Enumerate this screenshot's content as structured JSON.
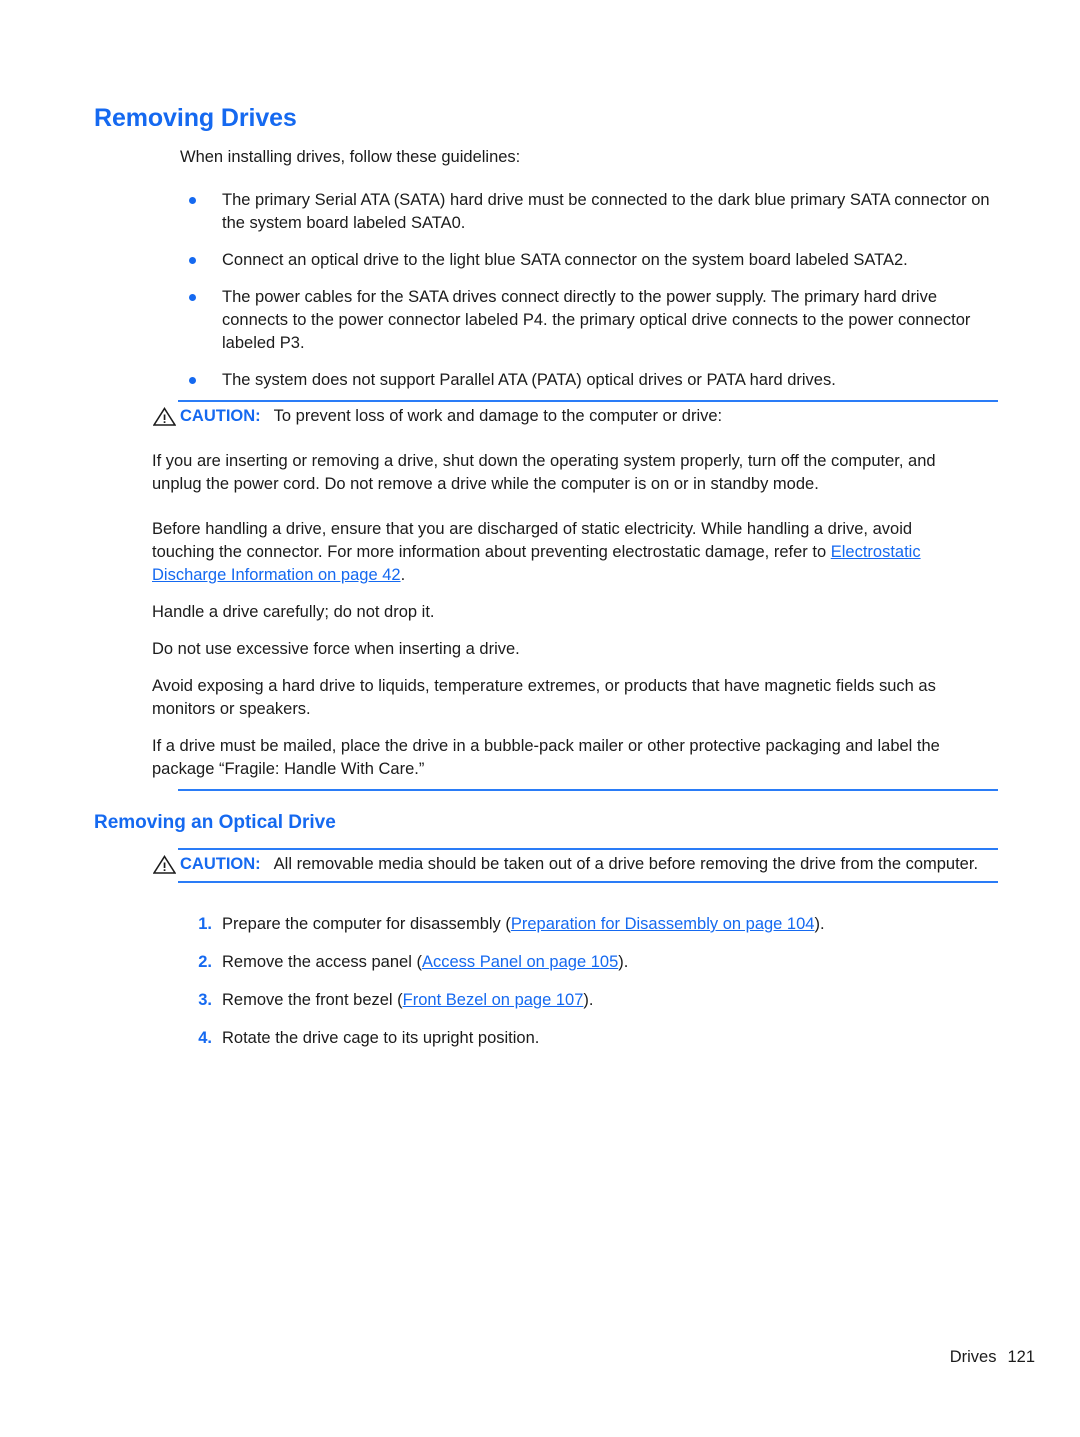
{
  "page": {
    "title": "Removing Drives",
    "intro": "When installing drives, follow these guidelines:",
    "accent_color": "#1569f0",
    "rule_color": "#2a7cf7",
    "text_color": "#1b1b1b"
  },
  "guidelines": [
    "The primary Serial ATA (SATA) hard drive must be connected to the dark blue primary SATA connector on the system board labeled SATA0.",
    "Connect an optical drive to the light blue SATA connector on the system board labeled SATA2.",
    "The power cables for the SATA drives connect directly to the power supply. The primary hard drive connects to the power connector labeled P4. the primary optical drive connects to the power connector labeled P3.",
    "The system does not support Parallel ATA (PATA) optical drives or PATA hard drives."
  ],
  "caution_1": {
    "icon": "warning-triangle-icon",
    "label": "CAUTION:",
    "lead": "To prevent loss of work and damage to the computer or drive:",
    "paragraphs": [
      "If you are inserting or removing a drive, shut down the operating system properly, turn off the computer, and unplug the power cord. Do not remove a drive while the computer is on or in standby mode.",
      "Handle a drive carefully; do not drop it.",
      "Do not use excessive force when inserting a drive.",
      "Avoid exposing a hard drive to liquids, temperature extremes, or products that have magnetic fields such as monitors or speakers.",
      "If a drive must be mailed, place the drive in a bubble-pack mailer or other protective packaging and label the package “Fragile: Handle With Care.”"
    ],
    "esd_paragraph": {
      "before": "Before handling a drive, ensure that you are discharged of static electricity. While handling a drive, avoid touching the connector. For more information about preventing electrostatic damage, refer to ",
      "link": "Electrostatic Discharge Information on page 42",
      "after": "."
    }
  },
  "section_2": {
    "title": "Removing an Optical Drive",
    "caution": {
      "icon": "warning-triangle-icon",
      "label": "CAUTION:",
      "text": "All removable media should be taken out of a drive before removing the drive from the computer."
    },
    "steps": [
      {
        "num": "1.",
        "before": "Prepare the computer for disassembly (",
        "link": "Preparation for Disassembly on page 104",
        "after": ")."
      },
      {
        "num": "2.",
        "before": "Remove the access panel (",
        "link": "Access Panel on page 105",
        "after": ")."
      },
      {
        "num": "3.",
        "before": "Remove the front bezel (",
        "link": "Front Bezel on page 107",
        "after": ")."
      },
      {
        "num": "4.",
        "before": "Rotate the drive cage to its upright position.",
        "link": "",
        "after": ""
      }
    ]
  },
  "footer": {
    "section": "Drives",
    "page_number": "121"
  }
}
